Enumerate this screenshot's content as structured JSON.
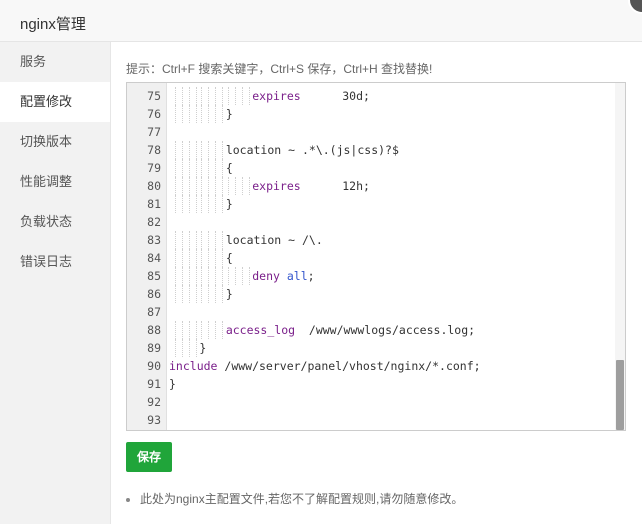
{
  "dialog": {
    "title": "nginx管理"
  },
  "sidebar": {
    "items": [
      {
        "label": "服务"
      },
      {
        "label": "配置修改",
        "active": true
      },
      {
        "label": "切换版本"
      },
      {
        "label": "性能调整"
      },
      {
        "label": "负载状态"
      },
      {
        "label": "错误日志"
      }
    ]
  },
  "main": {
    "hint": "提示：Ctrl+F 搜索关键字，Ctrl+S 保存，Ctrl+H 查找替换!",
    "save_label": "保存",
    "note": "此处为nginx主配置文件,若您不了解配置规则,请勿随意修改。"
  },
  "editor": {
    "lines": [
      {
        "n": "75",
        "text": "expires      30d;"
      },
      {
        "n": "76",
        "text": "}"
      },
      {
        "n": "77",
        "text": ""
      },
      {
        "n": "78",
        "text": "location ~ .*\\.(js|css)?$"
      },
      {
        "n": "79",
        "text": "{"
      },
      {
        "n": "80",
        "text": "expires      12h;"
      },
      {
        "n": "81",
        "text": "}"
      },
      {
        "n": "82",
        "text": ""
      },
      {
        "n": "83",
        "text": "location ~ /\\."
      },
      {
        "n": "84",
        "text": "{"
      },
      {
        "n": "85",
        "text": "deny all;"
      },
      {
        "n": "86",
        "text": "}"
      },
      {
        "n": "87",
        "text": ""
      },
      {
        "n": "88",
        "text": "access_log  /www/wwwlogs/access.log;"
      },
      {
        "n": "89",
        "text": "}"
      },
      {
        "n": "90",
        "text": "include /www/server/panel/vhost/nginx/*.conf;"
      },
      {
        "n": "91",
        "text": "}"
      },
      {
        "n": "92",
        "text": ""
      },
      {
        "n": "93",
        "text": ""
      }
    ]
  },
  "colors": {
    "accent": "#20a53a",
    "keyword": "#7a1f8a",
    "builtin": "#3355cc"
  },
  "icons": {
    "close": "close-icon"
  }
}
